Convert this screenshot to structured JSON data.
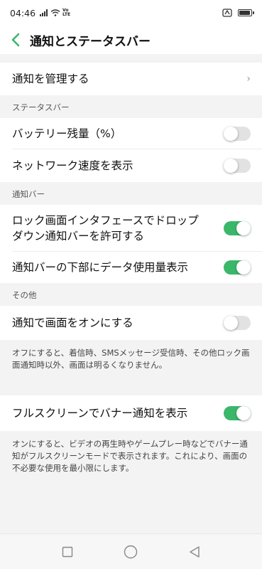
{
  "status_bar": {
    "time": "04:46",
    "volte": "Vo\nLTE",
    "battery_level": 0.95
  },
  "header": {
    "title": "通知とステータスバー"
  },
  "items": {
    "manage": {
      "label": "通知を管理する"
    },
    "status_bar_section": "ステータスバー",
    "battery_percent": {
      "label": "バッテリー残量（%）",
      "on": false
    },
    "network_speed": {
      "label": "ネットワーク速度を表示",
      "on": false
    },
    "notification_bar_section": "通知バー",
    "lockscreen_dropdown": {
      "label": "ロック画面インタフェースでドロップダウン通知バーを許可する",
      "on": true
    },
    "data_usage": {
      "label": "通知バーの下部にデータ使用量表示",
      "on": true
    },
    "other_section": "その他",
    "screen_on": {
      "label": "通知で画面をオンにする",
      "on": false,
      "description": "オフにすると、着信時、SMSメッセージ受信時、その他ロック画面通知時以外、画面は明るくなりません。"
    },
    "fullscreen_banner": {
      "label": "フルスクリーンでバナー通知を表示",
      "on": true,
      "description": "オンにすると、ビデオの再生時やゲームプレー時などでバナー通知がフルスクリーンモードで表示されます。これにより、画面の不必要な使用を最小限にします。"
    }
  },
  "colors": {
    "toggle_on": "#3bb76a",
    "toggle_off": "#e2e2e2",
    "back_arrow": "#3bb76a"
  },
  "nav": {
    "icons": [
      "recents-square-icon",
      "home-circle-icon",
      "back-triangle-icon"
    ]
  }
}
